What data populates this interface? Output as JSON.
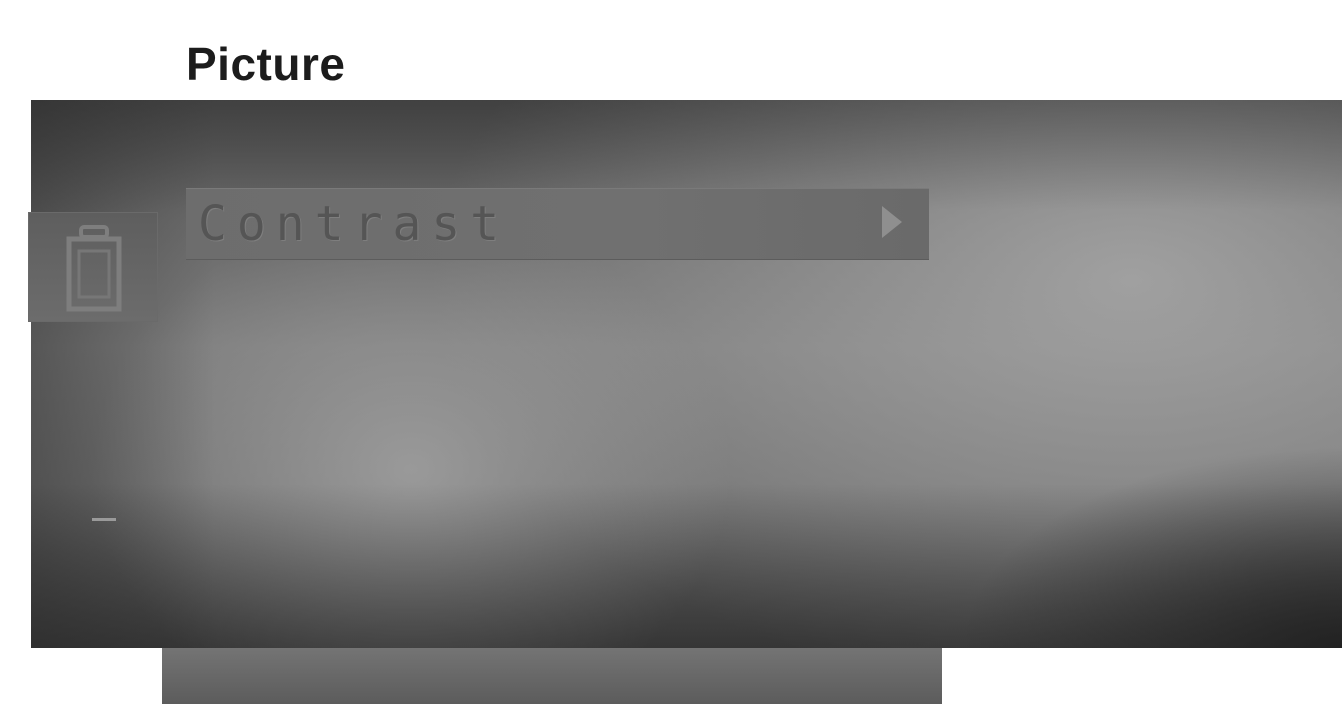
{
  "page": {
    "title": "Picture"
  },
  "menu": {
    "items": [
      {
        "label": "Contrast",
        "selected": true,
        "icon": "arrow-right-icon"
      }
    ]
  },
  "side_icon": {
    "name": "picture-category-icon"
  },
  "colors": {
    "title_text": "#1c1c1c",
    "osd_background": "#6e6e6e",
    "menu_highlight": "#6d6d6d",
    "menu_text": "#555555",
    "arrow": "#8f8f8f"
  }
}
